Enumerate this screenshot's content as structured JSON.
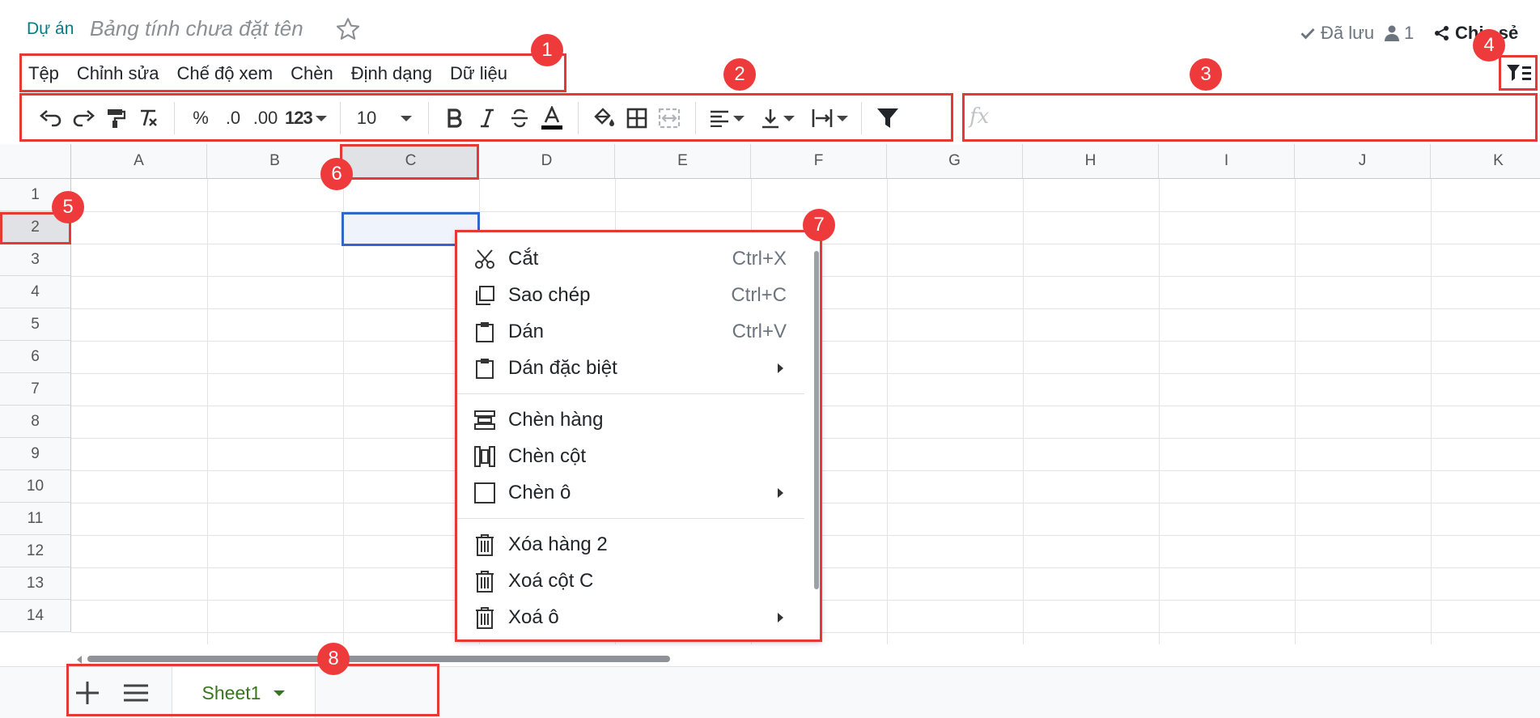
{
  "header": {
    "breadcrumb": "Dự án",
    "doc_title": "Bảng tính chưa đặt tên",
    "saved_label": "Đã lưu",
    "users_count": "1",
    "share_label": "Chia sẻ"
  },
  "menubar": {
    "items": [
      "Tệp",
      "Chỉnh sửa",
      "Chế độ xem",
      "Chèn",
      "Định dạng",
      "Dữ liệu"
    ]
  },
  "toolbar": {
    "percent": "%",
    "decrease_decimal": ".0",
    "increase_decimal": ".00",
    "number_format": "123",
    "font_size": "10"
  },
  "formula_bar": {
    "placeholder": "fx"
  },
  "grid": {
    "columns": [
      "A",
      "B",
      "C",
      "D",
      "E",
      "F",
      "G",
      "H",
      "I",
      "J",
      "K"
    ],
    "rows": [
      "1",
      "2",
      "3",
      "4",
      "5",
      "6",
      "7",
      "8",
      "9",
      "10",
      "11",
      "12",
      "13",
      "14"
    ],
    "selected_column": "C",
    "selected_row": "2"
  },
  "context_menu": {
    "items": [
      {
        "label": "Cắt",
        "shortcut": "Ctrl+X",
        "icon": "scissors-icon"
      },
      {
        "label": "Sao chép",
        "shortcut": "Ctrl+C",
        "icon": "copy-icon"
      },
      {
        "label": "Dán",
        "shortcut": "Ctrl+V",
        "icon": "clipboard-icon"
      },
      {
        "label": "Dán đặc biệt",
        "shortcut": "",
        "icon": "clipboard-icon",
        "submenu": true
      },
      {
        "label": "Chèn hàng",
        "shortcut": "",
        "icon": "insert-row-icon"
      },
      {
        "label": "Chèn cột",
        "shortcut": "",
        "icon": "insert-column-icon"
      },
      {
        "label": "Chèn ô",
        "shortcut": "",
        "icon": "insert-cell-icon",
        "submenu": true
      },
      {
        "label": "Xóa hàng 2",
        "shortcut": "",
        "icon": "trash-icon"
      },
      {
        "label": "Xoá cột C",
        "shortcut": "",
        "icon": "trash-icon"
      },
      {
        "label": "Xoá ô",
        "shortcut": "",
        "icon": "trash-icon",
        "submenu": true
      }
    ]
  },
  "bottombar": {
    "sheet_name": "Sheet1"
  },
  "annotations": [
    "1",
    "2",
    "3",
    "4",
    "5",
    "6",
    "7",
    "8"
  ],
  "colors": {
    "accent": "#017e84",
    "annotation": "#ee3a3a",
    "selection": "#3266ca",
    "sheet_tab": "#38761d"
  }
}
